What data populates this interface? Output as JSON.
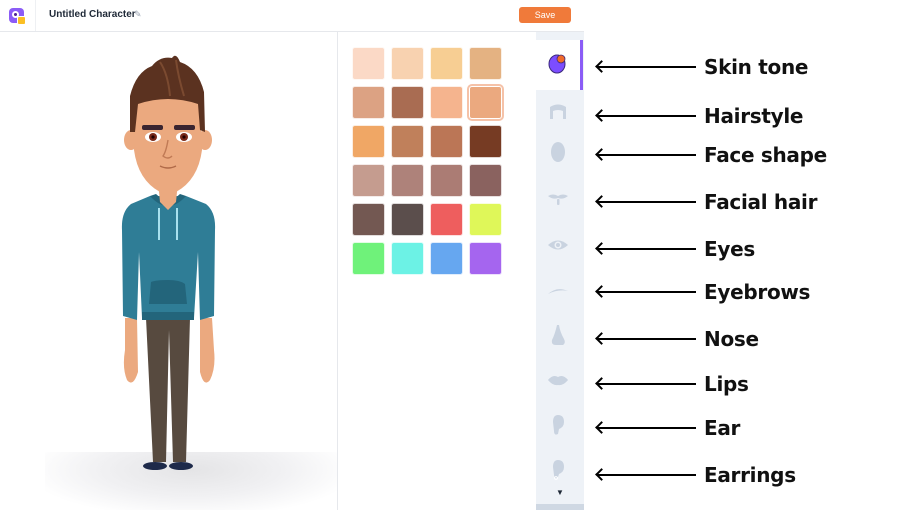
{
  "header": {
    "app_icon": "app-logo-icon",
    "title": "Untitled Character",
    "edit_icon": "pencil-icon",
    "save_label": "Save"
  },
  "colors": {
    "accent": "#8b5cf6",
    "save_button": "#f07a3a",
    "sidebar_bg": "#eef2f7",
    "sidebar_icon": "#c9d3e0"
  },
  "palette": {
    "selected_index": 7,
    "swatches": [
      "#fbd9c6",
      "#f8d2b0",
      "#f7ce93",
      "#e4b282",
      "#dca283",
      "#a96c52",
      "#f5b48e",
      "#eba97f",
      "#f0a765",
      "#c0805b",
      "#bb7656",
      "#763b23",
      "#c59c8f",
      "#ae827a",
      "#ab7c74",
      "#8a625f",
      "#735852",
      "#5b4e4c",
      "#ee5e5e",
      "#dff759",
      "#6ff27a",
      "#6cf2e5",
      "#66a7f0",
      "#a565ef"
    ]
  },
  "sidebar": {
    "items": [
      {
        "key": "skin-tone",
        "icon": "skin-tone-icon",
        "active": true
      },
      {
        "key": "hairstyle",
        "icon": "hairstyle-icon",
        "active": false
      },
      {
        "key": "face-shape",
        "icon": "face-shape-icon",
        "active": false
      },
      {
        "key": "facial-hair",
        "icon": "mustache-icon",
        "active": false
      },
      {
        "key": "eyes",
        "icon": "eye-icon",
        "active": false
      },
      {
        "key": "eyebrows",
        "icon": "eyebrow-icon",
        "active": false
      },
      {
        "key": "nose",
        "icon": "nose-icon",
        "active": false
      },
      {
        "key": "lips",
        "icon": "lips-icon",
        "active": false
      },
      {
        "key": "ear",
        "icon": "ear-icon",
        "active": false
      },
      {
        "key": "earrings",
        "icon": "earring-icon",
        "active": false
      }
    ],
    "more_icon": "caret-down-icon",
    "more_glyph": "▼"
  },
  "annotations": [
    "Skin tone",
    "Hairstyle",
    "Face shape",
    "Facial hair",
    "Eyes",
    "Eyebrows",
    "Nose",
    "Lips",
    "Ear",
    "Earrings"
  ],
  "character": {
    "skin": "#eba97f",
    "hair": "#5b3220",
    "hoodie": "#2f7d96",
    "hoodie_dark": "#23657b",
    "pants": "#574a3f",
    "shoes": "#1e2a4a"
  }
}
